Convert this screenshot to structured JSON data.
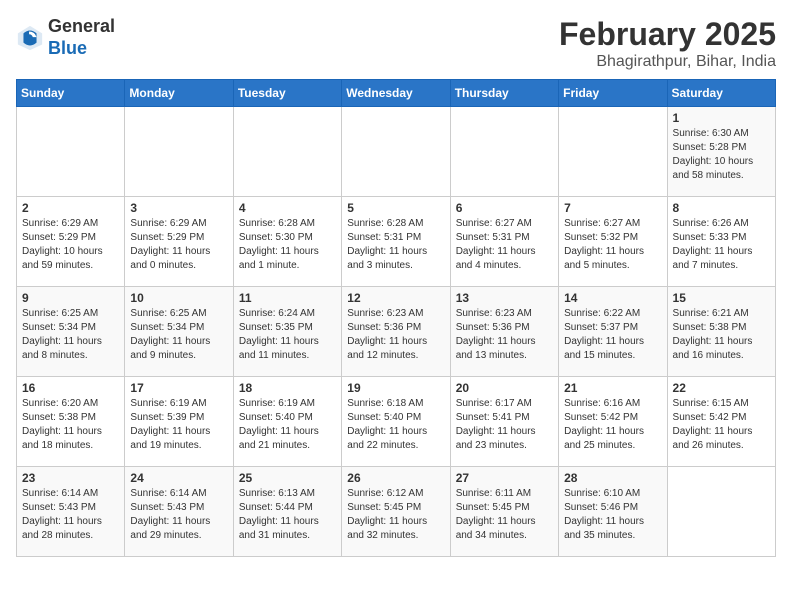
{
  "header": {
    "logo_general": "General",
    "logo_blue": "Blue",
    "month_year": "February 2025",
    "location": "Bhagirathpur, Bihar, India"
  },
  "weekdays": [
    "Sunday",
    "Monday",
    "Tuesday",
    "Wednesday",
    "Thursday",
    "Friday",
    "Saturday"
  ],
  "weeks": [
    [
      {
        "day": "",
        "info": ""
      },
      {
        "day": "",
        "info": ""
      },
      {
        "day": "",
        "info": ""
      },
      {
        "day": "",
        "info": ""
      },
      {
        "day": "",
        "info": ""
      },
      {
        "day": "",
        "info": ""
      },
      {
        "day": "1",
        "info": "Sunrise: 6:30 AM\nSunset: 5:28 PM\nDaylight: 10 hours\nand 58 minutes."
      }
    ],
    [
      {
        "day": "2",
        "info": "Sunrise: 6:29 AM\nSunset: 5:29 PM\nDaylight: 10 hours\nand 59 minutes."
      },
      {
        "day": "3",
        "info": "Sunrise: 6:29 AM\nSunset: 5:29 PM\nDaylight: 11 hours\nand 0 minutes."
      },
      {
        "day": "4",
        "info": "Sunrise: 6:28 AM\nSunset: 5:30 PM\nDaylight: 11 hours\nand 1 minute."
      },
      {
        "day": "5",
        "info": "Sunrise: 6:28 AM\nSunset: 5:31 PM\nDaylight: 11 hours\nand 3 minutes."
      },
      {
        "day": "6",
        "info": "Sunrise: 6:27 AM\nSunset: 5:31 PM\nDaylight: 11 hours\nand 4 minutes."
      },
      {
        "day": "7",
        "info": "Sunrise: 6:27 AM\nSunset: 5:32 PM\nDaylight: 11 hours\nand 5 minutes."
      },
      {
        "day": "8",
        "info": "Sunrise: 6:26 AM\nSunset: 5:33 PM\nDaylight: 11 hours\nand 7 minutes."
      }
    ],
    [
      {
        "day": "9",
        "info": "Sunrise: 6:25 AM\nSunset: 5:34 PM\nDaylight: 11 hours\nand 8 minutes."
      },
      {
        "day": "10",
        "info": "Sunrise: 6:25 AM\nSunset: 5:34 PM\nDaylight: 11 hours\nand 9 minutes."
      },
      {
        "day": "11",
        "info": "Sunrise: 6:24 AM\nSunset: 5:35 PM\nDaylight: 11 hours\nand 11 minutes."
      },
      {
        "day": "12",
        "info": "Sunrise: 6:23 AM\nSunset: 5:36 PM\nDaylight: 11 hours\nand 12 minutes."
      },
      {
        "day": "13",
        "info": "Sunrise: 6:23 AM\nSunset: 5:36 PM\nDaylight: 11 hours\nand 13 minutes."
      },
      {
        "day": "14",
        "info": "Sunrise: 6:22 AM\nSunset: 5:37 PM\nDaylight: 11 hours\nand 15 minutes."
      },
      {
        "day": "15",
        "info": "Sunrise: 6:21 AM\nSunset: 5:38 PM\nDaylight: 11 hours\nand 16 minutes."
      }
    ],
    [
      {
        "day": "16",
        "info": "Sunrise: 6:20 AM\nSunset: 5:38 PM\nDaylight: 11 hours\nand 18 minutes."
      },
      {
        "day": "17",
        "info": "Sunrise: 6:19 AM\nSunset: 5:39 PM\nDaylight: 11 hours\nand 19 minutes."
      },
      {
        "day": "18",
        "info": "Sunrise: 6:19 AM\nSunset: 5:40 PM\nDaylight: 11 hours\nand 21 minutes."
      },
      {
        "day": "19",
        "info": "Sunrise: 6:18 AM\nSunset: 5:40 PM\nDaylight: 11 hours\nand 22 minutes."
      },
      {
        "day": "20",
        "info": "Sunrise: 6:17 AM\nSunset: 5:41 PM\nDaylight: 11 hours\nand 23 minutes."
      },
      {
        "day": "21",
        "info": "Sunrise: 6:16 AM\nSunset: 5:42 PM\nDaylight: 11 hours\nand 25 minutes."
      },
      {
        "day": "22",
        "info": "Sunrise: 6:15 AM\nSunset: 5:42 PM\nDaylight: 11 hours\nand 26 minutes."
      }
    ],
    [
      {
        "day": "23",
        "info": "Sunrise: 6:14 AM\nSunset: 5:43 PM\nDaylight: 11 hours\nand 28 minutes."
      },
      {
        "day": "24",
        "info": "Sunrise: 6:14 AM\nSunset: 5:43 PM\nDaylight: 11 hours\nand 29 minutes."
      },
      {
        "day": "25",
        "info": "Sunrise: 6:13 AM\nSunset: 5:44 PM\nDaylight: 11 hours\nand 31 minutes."
      },
      {
        "day": "26",
        "info": "Sunrise: 6:12 AM\nSunset: 5:45 PM\nDaylight: 11 hours\nand 32 minutes."
      },
      {
        "day": "27",
        "info": "Sunrise: 6:11 AM\nSunset: 5:45 PM\nDaylight: 11 hours\nand 34 minutes."
      },
      {
        "day": "28",
        "info": "Sunrise: 6:10 AM\nSunset: 5:46 PM\nDaylight: 11 hours\nand 35 minutes."
      },
      {
        "day": "",
        "info": ""
      }
    ]
  ]
}
